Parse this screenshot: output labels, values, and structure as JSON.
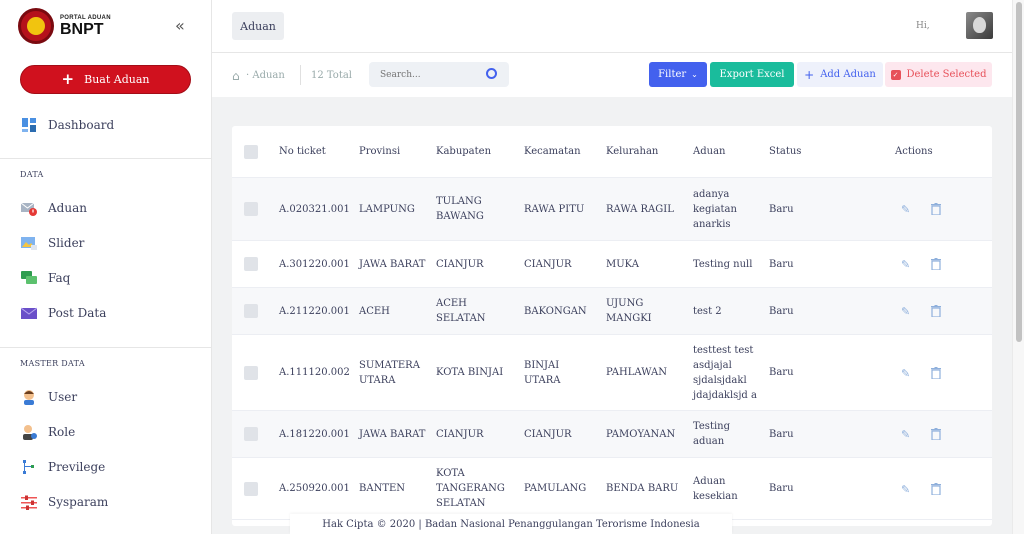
{
  "brand": {
    "small": "PORTAL ADUAN",
    "big": "BNPT"
  },
  "sidebar": {
    "collapse_icon": "«",
    "create_button": "Buat Aduan",
    "dashboard": "Dashboard",
    "section_data": "DATA",
    "data_items": [
      {
        "label": "Aduan",
        "icon": "mail-alert-icon"
      },
      {
        "label": "Slider",
        "icon": "image-icon"
      },
      {
        "label": "Faq",
        "icon": "chat-icon"
      },
      {
        "label": "Post Data",
        "icon": "envelope-icon"
      }
    ],
    "section_master": "MASTER DATA",
    "master_items": [
      {
        "label": "User",
        "icon": "user-icon"
      },
      {
        "label": "Role",
        "icon": "role-icon"
      },
      {
        "label": "Previlege",
        "icon": "tree-icon"
      },
      {
        "label": "Sysparam",
        "icon": "sliders-icon"
      }
    ]
  },
  "topbar": {
    "tab": "Aduan",
    "greeting": "Hi,"
  },
  "subbar": {
    "breadcrumb": "Aduan",
    "total": "12 Total",
    "search_placeholder": "Search...",
    "filter": "Filter",
    "excel": "Export Excel",
    "add": "Add Aduan",
    "delete": "Delete Selected"
  },
  "table": {
    "headers": {
      "ticket": "No ticket",
      "provinsi": "Provinsi",
      "kabupaten": "Kabupaten",
      "kecamatan": "Kecamatan",
      "kelurahan": "Kelurahan",
      "aduan": "Aduan",
      "status": "Status",
      "actions": "Actions"
    },
    "rows": [
      {
        "ticket": "A.020321.001",
        "provinsi": "LAMPUNG",
        "kabupaten": "TULANG BAWANG",
        "kecamatan": "RAWA PITU",
        "kelurahan": "RAWA RAGIL",
        "aduan": "adanya kegiatan anarkis",
        "status": "Baru"
      },
      {
        "ticket": "A.301220.001",
        "provinsi": "JAWA BARAT",
        "kabupaten": "CIANJUR",
        "kecamatan": "CIANJUR",
        "kelurahan": "MUKA",
        "aduan": "Testing null",
        "status": "Baru"
      },
      {
        "ticket": "A.211220.001",
        "provinsi": "ACEH",
        "kabupaten": "ACEH SELATAN",
        "kecamatan": "BAKONGAN",
        "kelurahan": "UJUNG MANGKI",
        "aduan": "test 2",
        "status": "Baru"
      },
      {
        "ticket": "A.111120.002",
        "provinsi": "SUMATERA UTARA",
        "kabupaten": "KOTA BINJAI",
        "kecamatan": "BINJAI UTARA",
        "kelurahan": "PAHLAWAN",
        "aduan": "testtest test asdjajal sjdalsjdakl jdajdaklsjd a",
        "status": "Baru"
      },
      {
        "ticket": "A.181220.001",
        "provinsi": "JAWA BARAT",
        "kabupaten": "CIANJUR",
        "kecamatan": "CIANJUR",
        "kelurahan": "PAMOYANAN",
        "aduan": "Testing aduan",
        "status": "Baru"
      },
      {
        "ticket": "A.250920.001",
        "provinsi": "BANTEN",
        "kabupaten": "KOTA TANGERANG SELATAN",
        "kecamatan": "PAMULANG",
        "kelurahan": "BENDA BARU",
        "aduan": "Aduan kesekian",
        "status": "Baru"
      }
    ]
  },
  "footer": "Hak Cipta © 2020 | Badan Nasional Penanggulangan Terorisme Indonesia",
  "colors": {
    "brand_red": "#d0111e",
    "primary": "#4361ee",
    "success": "#1abc9c",
    "danger": "#e7515a"
  }
}
